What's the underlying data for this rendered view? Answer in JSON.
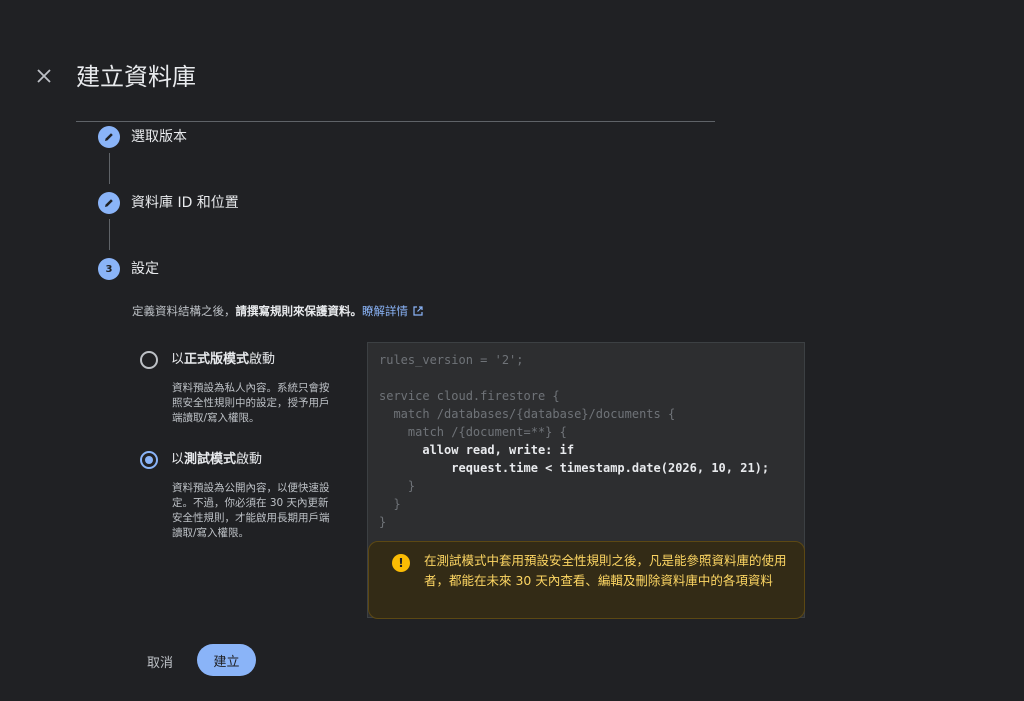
{
  "header": {
    "title": "建立資料庫"
  },
  "steps": [
    {
      "label": "選取版本",
      "state": "complete",
      "icon": "pencil-icon"
    },
    {
      "label": "資料庫 ID 和位置",
      "state": "complete",
      "icon": "pencil-icon"
    },
    {
      "label": "設定",
      "state": "active",
      "number": "3"
    }
  ],
  "settings": {
    "description_prefix": "定義資料結構之後，",
    "description_bold": "請撰寫規則來保護資料。",
    "learn_more": "瞭解詳情",
    "options": [
      {
        "label_prefix": "以",
        "label_bold": "正式版模式",
        "label_suffix": "啟動",
        "description": "資料預設為私人內容。系統只會按照安全性規則中的設定，授予用戶端讀取/寫入權限。",
        "selected": false
      },
      {
        "label_prefix": "以",
        "label_bold": "測試模式",
        "label_suffix": "啟動",
        "description": "資料預設為公開內容，以便快速設定。不過，你必須在 30 天內更新安全性規則，才能啟用長期用戶端讀取/寫入權限。",
        "selected": true
      }
    ]
  },
  "code": {
    "lines": [
      "rules_version = '2';",
      "",
      "service cloud.firestore {",
      "  match /databases/{database}/documents {",
      "    match /{document=**} {",
      "      allow read, write: if",
      "          request.time < timestamp.date(2026, 10, 21);",
      "    }",
      "  }",
      "}"
    ],
    "highlighted_lines": [
      5,
      6
    ]
  },
  "warning": {
    "icon": "warning-icon",
    "text": "在測試模式中套用預設安全性規則之後，凡是能參照資料庫的使用者，都能在未來 30 天內查看、編輯及刪除資料庫中的各項資料"
  },
  "actions": {
    "cancel": "取消",
    "create": "建立"
  },
  "colors": {
    "background": "#202124",
    "accent": "#8ab4f8",
    "warning_text": "#fdd663",
    "warning_icon": "#fbbc04"
  }
}
